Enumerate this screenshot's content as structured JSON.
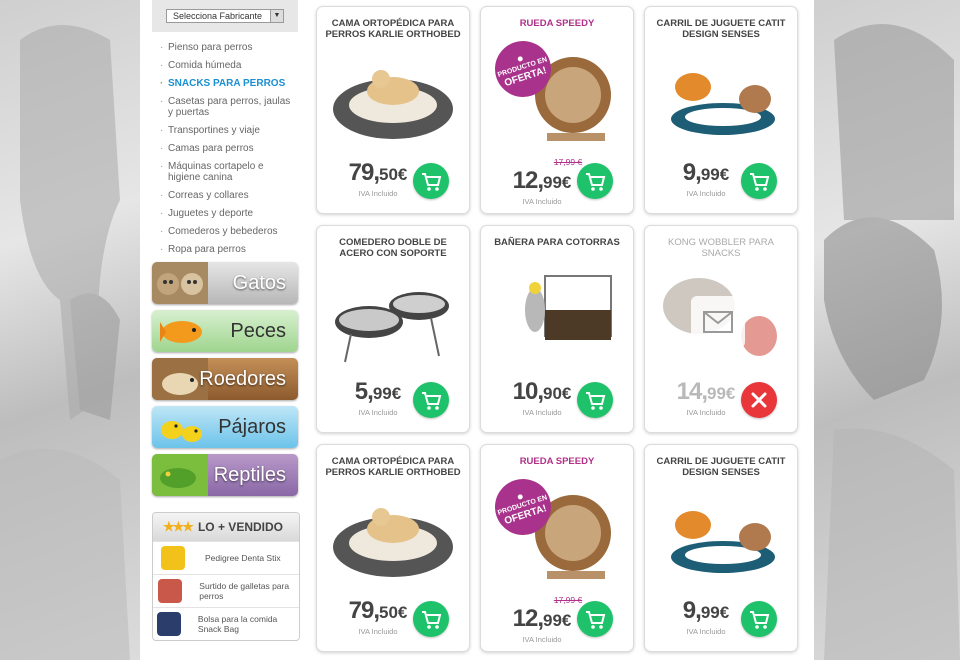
{
  "sidebar": {
    "maker_select": "Selecciona Fabricante",
    "categories": [
      "Pienso para perros",
      "Comida húmeda",
      "SNACKS PARA PERROS",
      "Casetas para perros, jaulas y puertas",
      "Transportines y viaje",
      "Camas para perros",
      "Máquinas cortapelo e higiene canina",
      "Correas y collares",
      "Juguetes y deporte",
      "Comederos y bebederos",
      "Ropa para perros"
    ],
    "animals": [
      "Gatos",
      "Peces",
      "Roedores",
      "Pájaros",
      "Reptiles"
    ],
    "best_title": "LO + VENDIDO",
    "best_items": [
      "Pedigree Denta Stix",
      "Surtido de galletas para perros",
      "Bolsa para la comida Snack Bag"
    ]
  },
  "products": [
    {
      "title": "CAMA ORTOPÉDICA PARA PERROS KARLIE ORTHOBED",
      "price_int": "79,",
      "price_dec": "50€",
      "iva": "IVA Incluido"
    },
    {
      "title": "RUEDA SPEEDY",
      "old": "17,99 €",
      "price_int": "12,",
      "price_dec": "99€",
      "iva": "IVA Incluido",
      "badge_top": "PRODUCTO EN",
      "badge_big": "OFERTA!"
    },
    {
      "title": "CARRIL DE JUGUETE CATIT DESIGN SENSES",
      "price_int": "9,",
      "price_dec": "99€",
      "iva": "IVA Incluido"
    },
    {
      "title": "COMEDERO DOBLE DE ACERO CON SOPORTE",
      "price_int": "5,",
      "price_dec": "99€",
      "iva": "IVA Incluido"
    },
    {
      "title": "BAÑERA PARA COTORRAS",
      "price_int": "10,",
      "price_dec": "90€",
      "iva": "IVA Incluido"
    },
    {
      "title": "KONG WOBBLER PARA SNACKS",
      "price_int": "14,",
      "price_dec": "99€",
      "iva": "IVA Incluido"
    },
    {
      "title": "CAMA ORTOPÉDICA PARA PERROS KARLIE ORTHOBED",
      "price_int": "79,",
      "price_dec": "50€",
      "iva": "IVA Incluido"
    },
    {
      "title": "RUEDA SPEEDY",
      "old": "17,99 €",
      "price_int": "12,",
      "price_dec": "99€",
      "iva": "IVA Incluido",
      "badge_top": "PRODUCTO EN",
      "badge_big": "OFERTA!"
    },
    {
      "title": "CARRIL DE JUGUETE CATIT DESIGN SENSES",
      "price_int": "9,",
      "price_dec": "99€",
      "iva": "IVA Incluido"
    }
  ],
  "colors": {
    "accent": "#1a8fd1",
    "cart": "#1ec26a",
    "soldout": "#e8363b",
    "offer": "#b0308a"
  },
  "icons": {
    "cart": "shopping-cart-icon",
    "soldout": "close-icon",
    "mail": "envelope-icon"
  }
}
